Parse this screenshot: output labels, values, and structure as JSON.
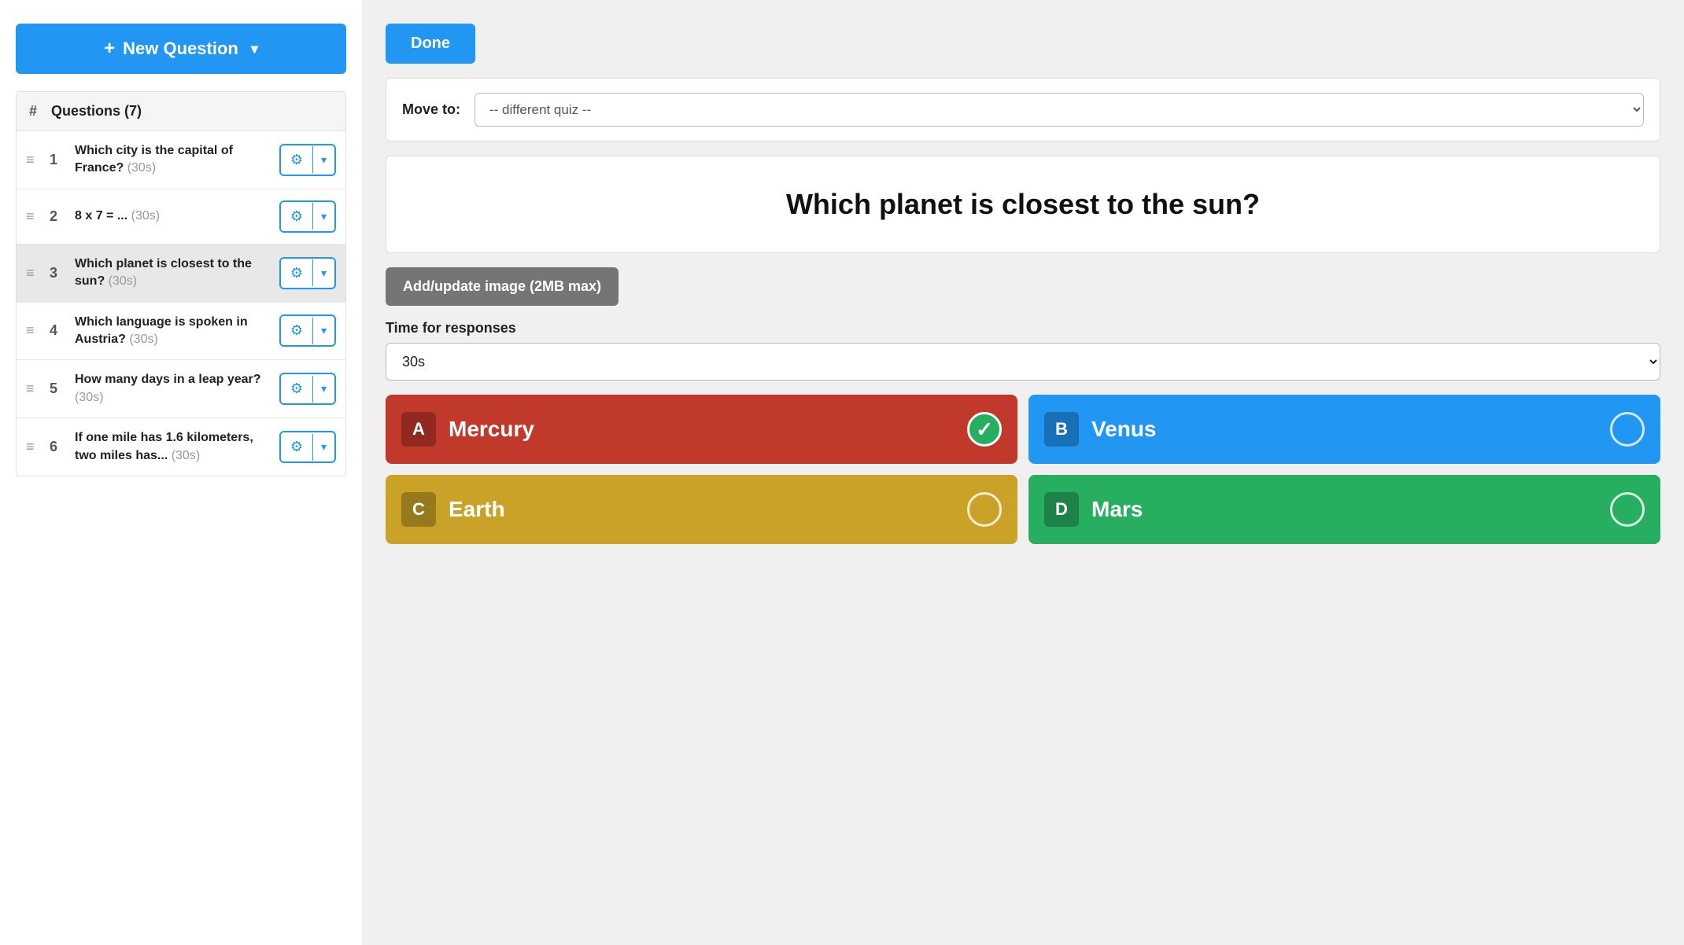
{
  "left": {
    "new_question_label": "+ New Question ▾",
    "new_question_plus": "+",
    "new_question_text": "New Question",
    "new_question_chevron": "▾",
    "header": {
      "hash": "#",
      "title": "Questions (7)"
    },
    "questions": [
      {
        "num": 1,
        "text": "Which city is the capital of France?",
        "time": "(30s)",
        "active": false
      },
      {
        "num": 2,
        "text": "8 x 7 = ...",
        "time": "(30s)",
        "active": false
      },
      {
        "num": 3,
        "text": "Which planet is closest to the sun?",
        "time": "(30s)",
        "active": true
      },
      {
        "num": 4,
        "text": "Which language is spoken in Austria?",
        "time": "(30s)",
        "active": false
      },
      {
        "num": 5,
        "text": "How many days in a leap year?",
        "time": "(30s)",
        "active": false
      },
      {
        "num": 6,
        "text": "If one mile has 1.6 kilometers, two miles has...",
        "time": "(30s)",
        "active": false
      }
    ]
  },
  "right": {
    "done_label": "Done",
    "move_to_label": "Move to:",
    "move_to_placeholder": "-- different quiz --",
    "question_text": "Which planet is closest to the sun?",
    "add_image_label": "Add/update image (2MB max)",
    "time_for_responses_label": "Time for responses",
    "time_selected": "30s",
    "answers": [
      {
        "letter": "A",
        "text": "Mercury",
        "color": "red",
        "correct": true
      },
      {
        "letter": "B",
        "text": "Venus",
        "color": "blue",
        "correct": false
      },
      {
        "letter": "C",
        "text": "Earth",
        "color": "yellow",
        "correct": false
      },
      {
        "letter": "D",
        "text": "Mars",
        "color": "green",
        "correct": false
      }
    ]
  }
}
